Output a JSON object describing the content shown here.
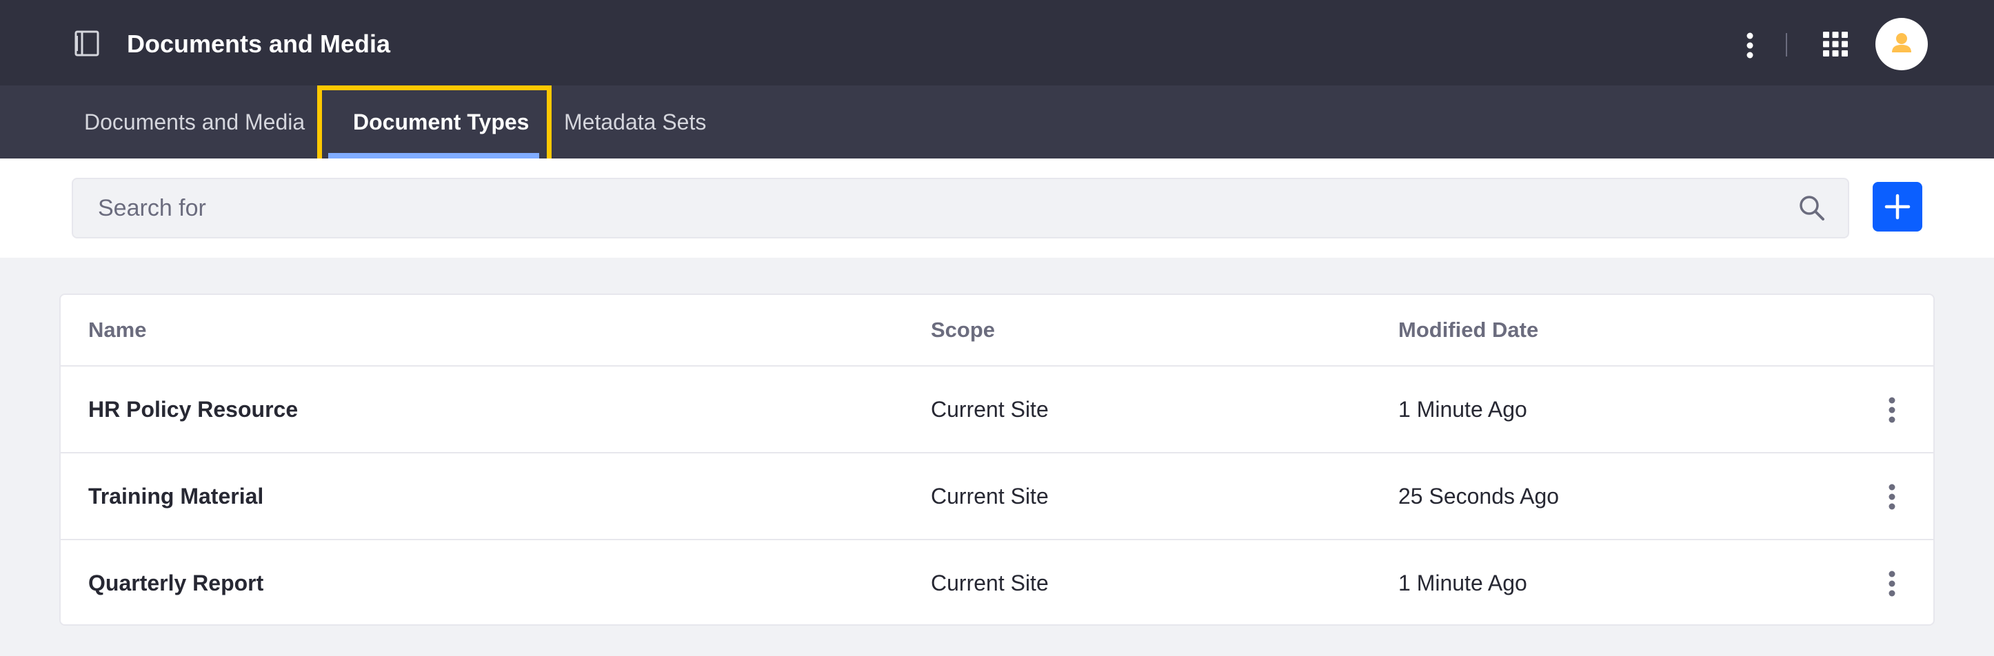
{
  "header": {
    "title": "Documents and Media",
    "icons": {
      "panel_toggle": "product-menu-icon",
      "options": "vertical-ellipsis-icon",
      "apps": "apps-grid-icon",
      "avatar": "user-avatar-icon"
    }
  },
  "nav": {
    "tabs": [
      {
        "label": "Documents and Media",
        "active": false
      },
      {
        "label": "Document Types",
        "active": true
      },
      {
        "label": "Metadata Sets",
        "active": false
      }
    ],
    "highlight_color": "#ffc800"
  },
  "toolbar": {
    "search_placeholder": "Search for",
    "search_value": "",
    "search_icon": "search-icon",
    "add_icon": "plus-icon"
  },
  "table": {
    "columns": [
      "Name",
      "Scope",
      "Modified Date"
    ],
    "rows": [
      {
        "name": "HR Policy Resource",
        "scope": "Current Site",
        "modified": "1 Minute Ago"
      },
      {
        "name": "Training Material",
        "scope": "Current Site",
        "modified": "25 Seconds Ago"
      },
      {
        "name": "Quarterly Report",
        "scope": "Current Site",
        "modified": "1 Minute Ago"
      }
    ]
  },
  "colors": {
    "header_bg": "#30313f",
    "nav_bg": "#393a4a",
    "accent": "#0b5fff",
    "tab_underline": "#80acff",
    "avatar_accent": "#ffc04d"
  }
}
